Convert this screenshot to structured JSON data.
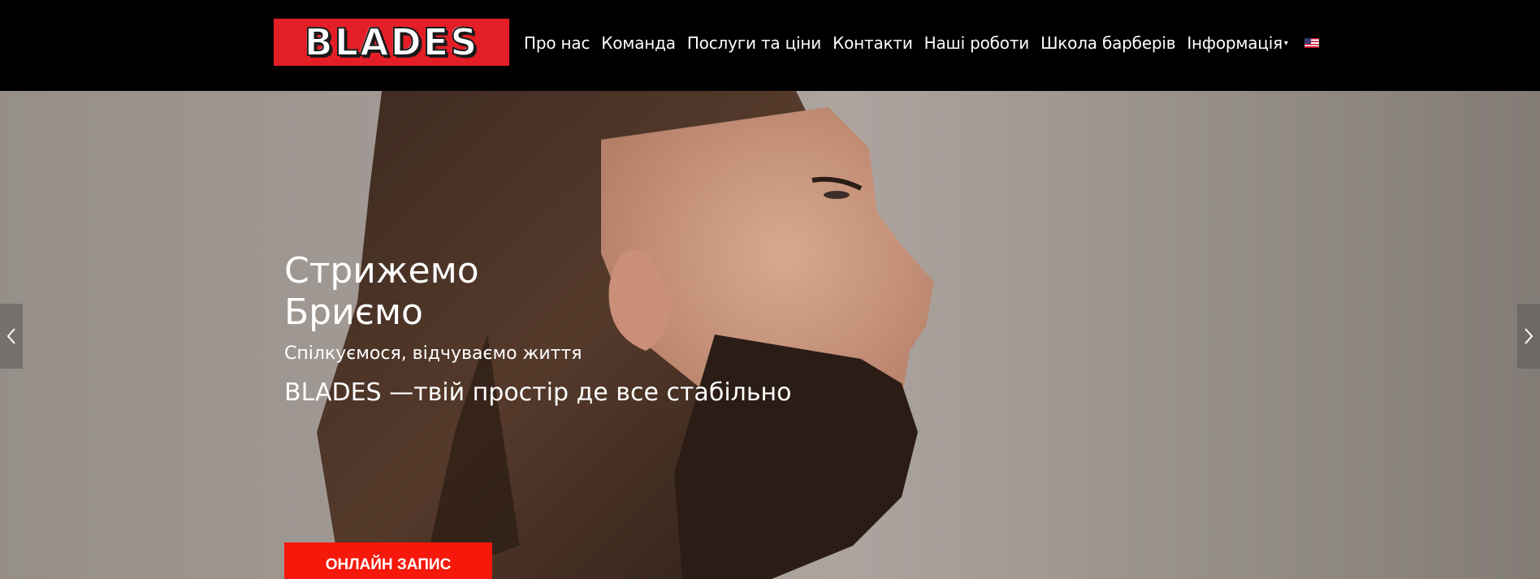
{
  "brand": {
    "logo_text": "BLADES"
  },
  "nav": {
    "items": [
      {
        "label": "Про нас"
      },
      {
        "label": "Команда"
      },
      {
        "label": "Послуги та ціни"
      },
      {
        "label": "Контакти"
      },
      {
        "label": "Наші роботи"
      },
      {
        "label": "Школа барберів"
      },
      {
        "label": "Інформація"
      }
    ],
    "dropdown_caret": "▾",
    "language_flag": "us-flag-icon"
  },
  "hero": {
    "title_line1": "Стрижемо",
    "title_line2": "Бриємо",
    "subtitle": "Спілкуємося, відчуваємо життя",
    "tagline": "BLADES —твій простір де все стабільно",
    "cta_label": "ОНЛАЙН ЗАПИС",
    "prev_icon": "chevron-left-icon",
    "next_icon": "chevron-right-icon"
  },
  "colors": {
    "navbar_bg": "#000000",
    "logo_red": "#e41e26",
    "cta_red": "#f5180b",
    "text_white": "#ffffff"
  }
}
